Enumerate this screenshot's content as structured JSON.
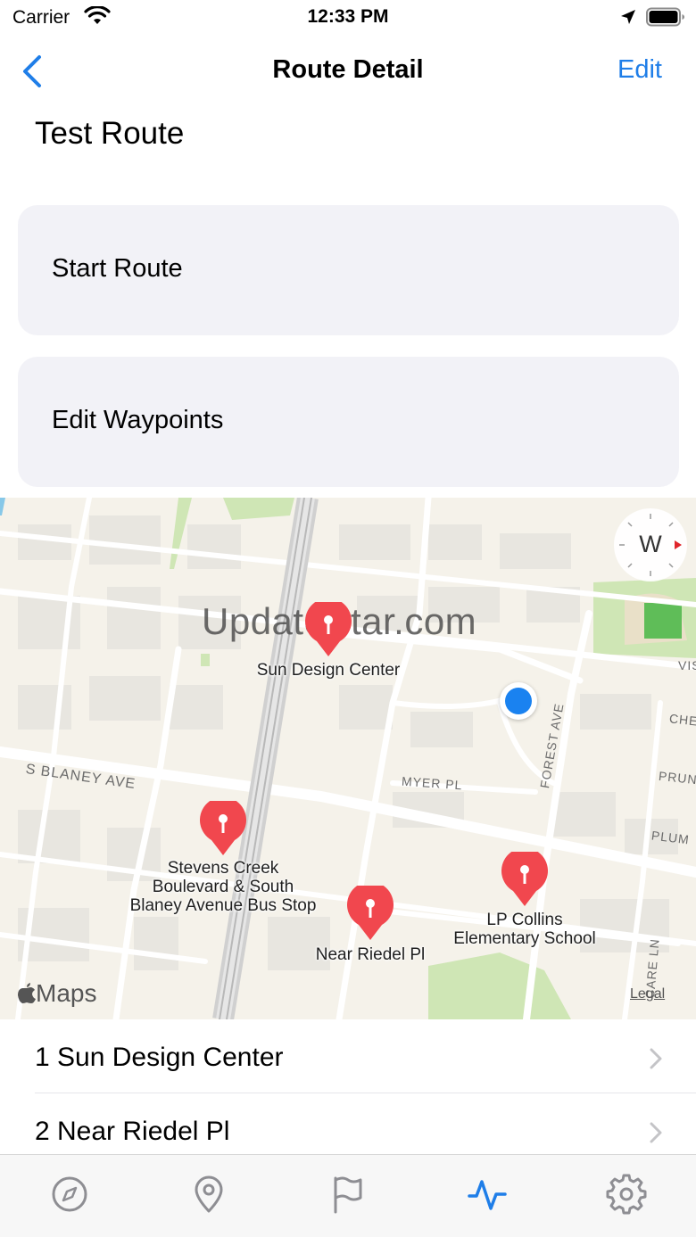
{
  "status_bar": {
    "carrier": "Carrier",
    "time": "12:33 PM"
  },
  "nav": {
    "title": "Route Detail",
    "edit_label": "Edit"
  },
  "route": {
    "name": "Test Route"
  },
  "actions": {
    "start_route": "Start Route",
    "edit_waypoints": "Edit Waypoints"
  },
  "map": {
    "watermark": "UpdateStar.com",
    "compass_heading": "W",
    "maps_label": "Maps",
    "legal_label": "Legal",
    "pins": [
      {
        "label": "Sun Design Center"
      },
      {
        "label": "Stevens Creek\nBoulevard & South\nBlaney Avenue Bus Stop"
      },
      {
        "label": "Near Riedel Pl"
      },
      {
        "label": "LP Collins\nElementary School"
      }
    ],
    "streets": [
      "S BLANEY AVE",
      "MYER PL",
      "FOREST AVE",
      "PLUM",
      "PRUN",
      "CHE",
      "VIS",
      "CARE LN"
    ]
  },
  "waypoints": [
    {
      "label": "1 Sun Design Center"
    },
    {
      "label": "2 Near Riedel Pl"
    }
  ],
  "tabs": [
    {
      "icon": "compass-icon"
    },
    {
      "icon": "map-pin-icon"
    },
    {
      "icon": "flag-icon"
    },
    {
      "icon": "activity-icon",
      "active": true
    },
    {
      "icon": "gear-icon"
    }
  ],
  "colors": {
    "accent": "#1f7ee8",
    "pin": "#f1474e",
    "user_location": "#1a82f0",
    "card_bg": "#f2f2f7"
  }
}
